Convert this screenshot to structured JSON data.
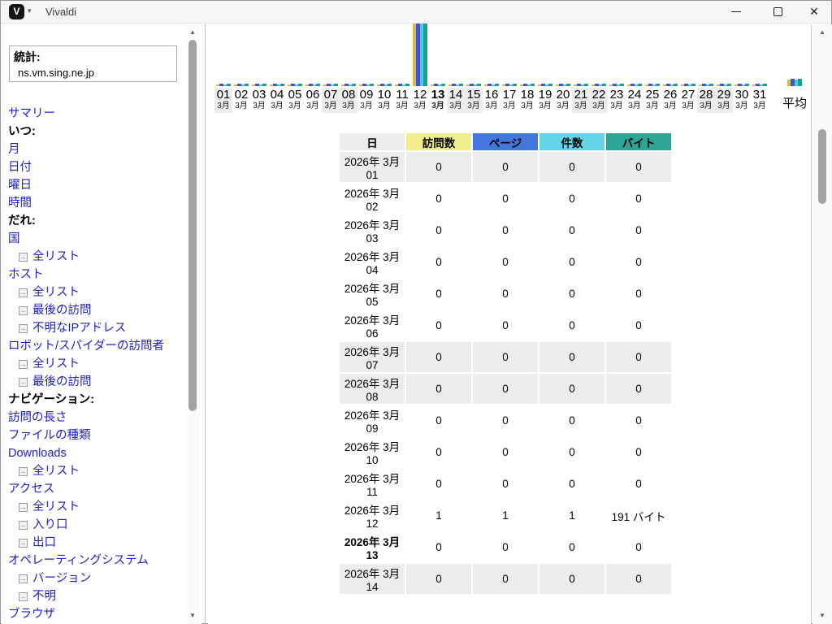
{
  "window": {
    "title": "Vivaldi"
  },
  "icons": {
    "vivaldi_logo": "V",
    "menu_chevron": "▾",
    "close": "✕",
    "sublink_arrow": "→",
    "scroll_up": "▲",
    "scroll_down": "▼"
  },
  "sidebar": {
    "stats_label": "統計:",
    "hostname": "ns.vm.sing.ne.jp",
    "items": [
      {
        "label": "サマリー",
        "type": "link"
      },
      {
        "label": "いつ:",
        "type": "header"
      },
      {
        "label": "月",
        "type": "link"
      },
      {
        "label": "日付",
        "type": "link"
      },
      {
        "label": "曜日",
        "type": "link"
      },
      {
        "label": "時間",
        "type": "link"
      },
      {
        "label": "だれ:",
        "type": "header"
      },
      {
        "label": "国",
        "type": "link"
      },
      {
        "label": "全リスト",
        "type": "sublink"
      },
      {
        "label": "ホスト",
        "type": "link"
      },
      {
        "label": "全リスト",
        "type": "sublink"
      },
      {
        "label": "最後の訪問",
        "type": "sublink"
      },
      {
        "label": "不明なIPアドレス",
        "type": "sublink"
      },
      {
        "label": "ロボット/スパイダーの訪問者",
        "type": "link"
      },
      {
        "label": "全リスト",
        "type": "sublink"
      },
      {
        "label": "最後の訪問",
        "type": "sublink"
      },
      {
        "label": "ナビゲーション:",
        "type": "header"
      },
      {
        "label": "訪問の長さ",
        "type": "link"
      },
      {
        "label": "ファイルの種類",
        "type": "link"
      },
      {
        "label": "Downloads",
        "type": "link"
      },
      {
        "label": "全リスト",
        "type": "sublink"
      },
      {
        "label": "アクセス",
        "type": "link"
      },
      {
        "label": "全リスト",
        "type": "sublink"
      },
      {
        "label": "入り口",
        "type": "sublink"
      },
      {
        "label": "出口",
        "type": "sublink"
      },
      {
        "label": "オペレーティングシステム",
        "type": "link"
      },
      {
        "label": "バージョン",
        "type": "sublink"
      },
      {
        "label": "不明",
        "type": "sublink"
      },
      {
        "label": "ブラウザ",
        "type": "link"
      }
    ]
  },
  "chart_data": {
    "type": "bar",
    "month_label": "3月",
    "average_label": "平均",
    "days": [
      "01",
      "02",
      "03",
      "04",
      "05",
      "06",
      "07",
      "08",
      "09",
      "10",
      "11",
      "12",
      "13",
      "14",
      "15",
      "16",
      "17",
      "18",
      "19",
      "20",
      "21",
      "22",
      "23",
      "24",
      "25",
      "26",
      "27",
      "28",
      "29",
      "30",
      "31"
    ],
    "weekend_days": [
      1,
      7,
      8,
      14,
      15,
      21,
      22,
      28,
      29
    ],
    "today_day": 13,
    "series": [
      {
        "name": "訪問数",
        "color": "#D9BE3E",
        "values": [
          0,
          0,
          0,
          0,
          0,
          0,
          0,
          0,
          0,
          0,
          0,
          1,
          0,
          0,
          0,
          0,
          0,
          0,
          0,
          0,
          0,
          0,
          0,
          0,
          0,
          0,
          0,
          0,
          0,
          0,
          0
        ]
      },
      {
        "name": "ページ",
        "color": "#3D55D8",
        "values": [
          0,
          0,
          0,
          0,
          0,
          0,
          0,
          0,
          0,
          0,
          0,
          1,
          0,
          0,
          0,
          0,
          0,
          0,
          0,
          0,
          0,
          0,
          0,
          0,
          0,
          0,
          0,
          0,
          0,
          0,
          0
        ]
      },
      {
        "name": "件数",
        "color": "#4FC8E4",
        "values": [
          0,
          0,
          0,
          0,
          0,
          0,
          0,
          0,
          0,
          0,
          0,
          1,
          0,
          0,
          0,
          0,
          0,
          0,
          0,
          0,
          0,
          0,
          0,
          0,
          0,
          0,
          0,
          0,
          0,
          0,
          0
        ]
      },
      {
        "name": "バイト",
        "color": "#16A189",
        "values": [
          0,
          0,
          0,
          0,
          0,
          0,
          0,
          0,
          0,
          0,
          0,
          191,
          0,
          0,
          0,
          0,
          0,
          0,
          0,
          0,
          0,
          0,
          0,
          0,
          0,
          0,
          0,
          0,
          0,
          0,
          0
        ]
      }
    ]
  },
  "table": {
    "headers": [
      {
        "label": "日",
        "color": "#ECECEC"
      },
      {
        "label": "訪問数",
        "color": "#F1EE8D"
      },
      {
        "label": "ページ",
        "color": "#4477DD"
      },
      {
        "label": "件数",
        "color": "#62D3E8"
      },
      {
        "label": "バイト",
        "color": "#2EA495"
      }
    ],
    "rows": [
      {
        "date": "2026年 3月 01",
        "visits": "0",
        "pages": "0",
        "hits": "0",
        "bytes": "0",
        "weekend": true,
        "bold": false
      },
      {
        "date": "2026年 3月 02",
        "visits": "0",
        "pages": "0",
        "hits": "0",
        "bytes": "0",
        "weekend": false,
        "bold": false
      },
      {
        "date": "2026年 3月 03",
        "visits": "0",
        "pages": "0",
        "hits": "0",
        "bytes": "0",
        "weekend": false,
        "bold": false
      },
      {
        "date": "2026年 3月 04",
        "visits": "0",
        "pages": "0",
        "hits": "0",
        "bytes": "0",
        "weekend": false,
        "bold": false
      },
      {
        "date": "2026年 3月 05",
        "visits": "0",
        "pages": "0",
        "hits": "0",
        "bytes": "0",
        "weekend": false,
        "bold": false
      },
      {
        "date": "2026年 3月 06",
        "visits": "0",
        "pages": "0",
        "hits": "0",
        "bytes": "0",
        "weekend": false,
        "bold": false
      },
      {
        "date": "2026年 3月 07",
        "visits": "0",
        "pages": "0",
        "hits": "0",
        "bytes": "0",
        "weekend": true,
        "bold": false
      },
      {
        "date": "2026年 3月 08",
        "visits": "0",
        "pages": "0",
        "hits": "0",
        "bytes": "0",
        "weekend": true,
        "bold": false
      },
      {
        "date": "2026年 3月 09",
        "visits": "0",
        "pages": "0",
        "hits": "0",
        "bytes": "0",
        "weekend": false,
        "bold": false
      },
      {
        "date": "2026年 3月 10",
        "visits": "0",
        "pages": "0",
        "hits": "0",
        "bytes": "0",
        "weekend": false,
        "bold": false
      },
      {
        "date": "2026年 3月 11",
        "visits": "0",
        "pages": "0",
        "hits": "0",
        "bytes": "0",
        "weekend": false,
        "bold": false
      },
      {
        "date": "2026年 3月 12",
        "visits": "1",
        "pages": "1",
        "hits": "1",
        "bytes": "191 バイト",
        "weekend": false,
        "bold": false
      },
      {
        "date": "2026年 3月 13",
        "visits": "0",
        "pages": "0",
        "hits": "0",
        "bytes": "0",
        "weekend": false,
        "bold": true
      },
      {
        "date": "2026年 3月 14",
        "visits": "0",
        "pages": "0",
        "hits": "0",
        "bytes": "0",
        "weekend": true,
        "bold": false
      }
    ]
  }
}
